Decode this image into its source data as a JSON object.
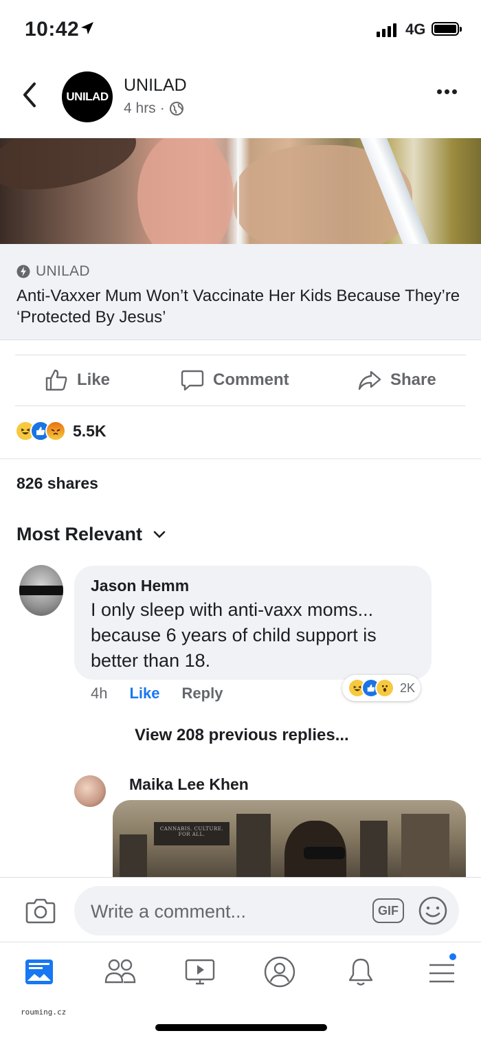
{
  "status_bar": {
    "time": "10:42",
    "network": "4G"
  },
  "post": {
    "page_name": "UNILAD",
    "avatar_text": "UNILAD",
    "time_ago": "4 hrs",
    "meta_sep": "·",
    "link": {
      "source": "UNILAD",
      "title": "Anti-Vaxxer Mum Won’t Vaccinate Her Kids Because They’re ‘Protected By Jesus’"
    },
    "actions": {
      "like": "Like",
      "comment": "Comment",
      "share": "Share"
    },
    "reaction_count": "5.5K",
    "shares": "826 shares"
  },
  "comments": {
    "sort_label": "Most Relevant",
    "top": {
      "author": "Jason Hemm",
      "text": "I only sleep with anti-vaxx moms... because 6 years of child support is better than 18.",
      "time": "4h",
      "like_label": "Like",
      "reply_label": "Reply",
      "reaction_count": "2K"
    },
    "view_previous": "View 208 previous replies...",
    "reply": {
      "author": "Maika Lee Khen",
      "gif_sign": "CANNABIS. CULTURE. FOR ALL."
    }
  },
  "composer": {
    "placeholder": "Write a comment...",
    "gif_label": "GIF"
  },
  "watermark": "rouming.cz",
  "colors": {
    "accent": "#1877f2",
    "secondary_text": "#65676b",
    "bubble": "#f0f2f5"
  }
}
